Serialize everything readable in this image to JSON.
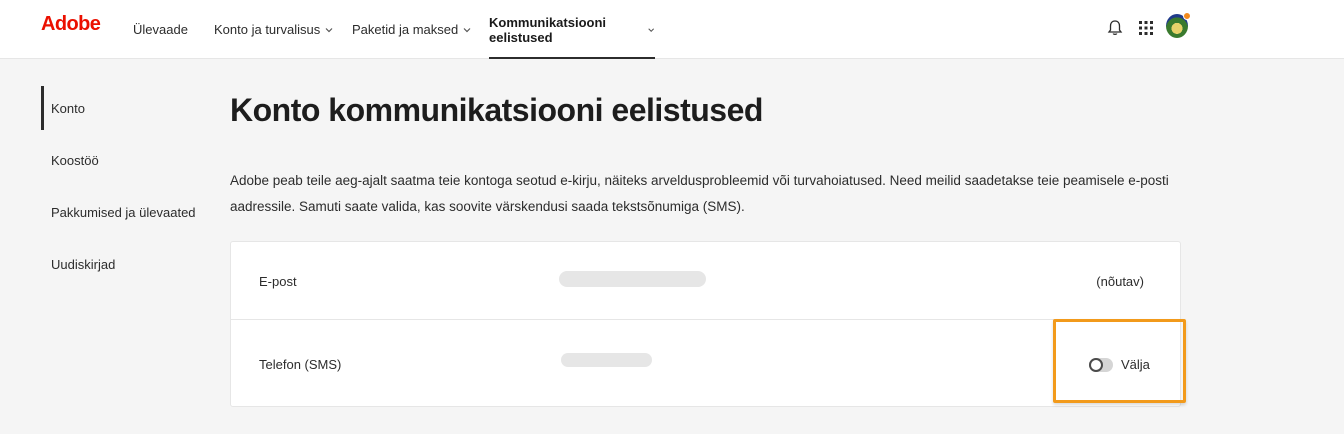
{
  "brand": {
    "logo_text": "Adobe",
    "logo_color": "#eb1000"
  },
  "nav": {
    "items": [
      {
        "label": "Ülevaade"
      },
      {
        "label": "Konto ja turvalisus"
      },
      {
        "label": "Paketid ja maksed"
      },
      {
        "label": "Kommunikatsiooni eelistused"
      }
    ],
    "active_index": 3
  },
  "header_icons": [
    "bell-icon",
    "app-grid-icon",
    "avatar"
  ],
  "sidebar": {
    "items": [
      {
        "label": "Konto"
      },
      {
        "label": "Koostöö"
      },
      {
        "label": "Pakkumised ja ülevaated"
      },
      {
        "label": "Uudiskirjad"
      }
    ],
    "active_index": 0
  },
  "main": {
    "title": "Konto kommunikatsiooni eelistused",
    "description": "Adobe peab teile aeg-ajalt saatma teie kontoga seotud e-kirju, näiteks arveldusprobleemid või turvahoiatused. Need meilid saadetakse teie peamisele e-posti aadressile. Samuti saate valida, kas soovite värskendusi saada tekstsõnumiga (SMS).",
    "rows": [
      {
        "label": "E-post",
        "status": "(nõutav)"
      },
      {
        "label": "Telefon (SMS)",
        "toggle_label": "Välja",
        "toggle_on": false
      }
    ]
  },
  "colors": {
    "highlight": "#f29a1b",
    "active_underline": "#2c2c2c"
  }
}
